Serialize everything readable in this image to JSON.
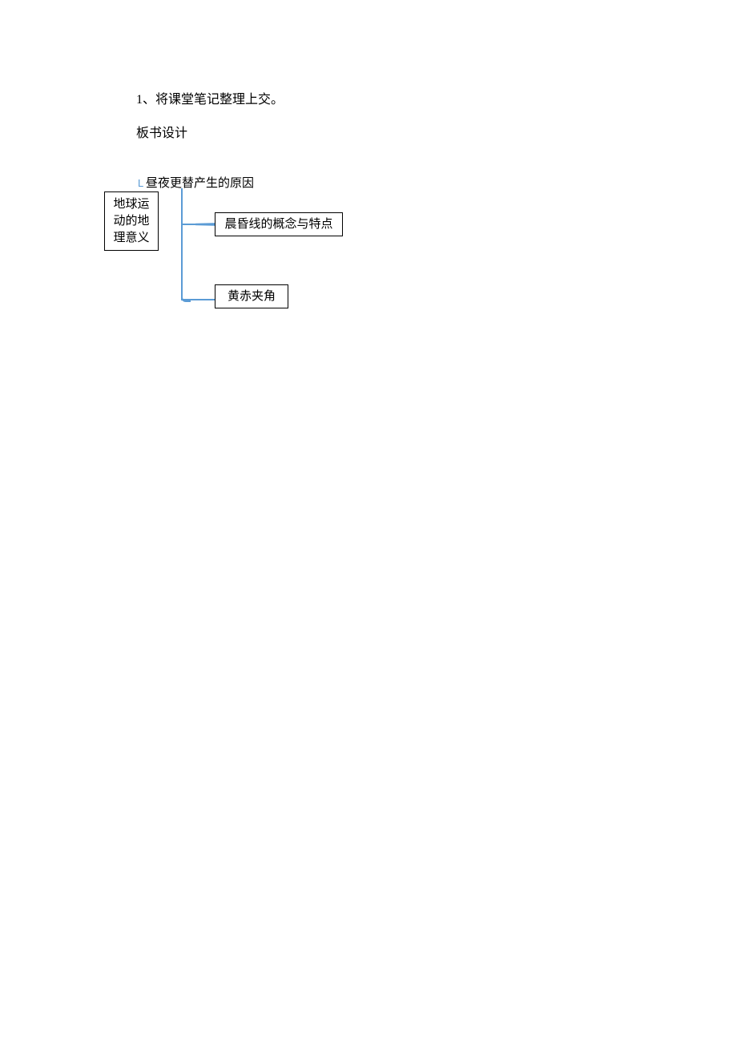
{
  "lines": {
    "item1": "1、将课堂笔记整理上交。",
    "item2": "板书设计"
  },
  "diagram": {
    "top_label": "昼夜更替产生的原因",
    "left_box": "地球运动的地理意义",
    "mid_box": "晨昏线的概念与特点",
    "bottom_box": "黄赤夹角",
    "small_l": "L"
  }
}
